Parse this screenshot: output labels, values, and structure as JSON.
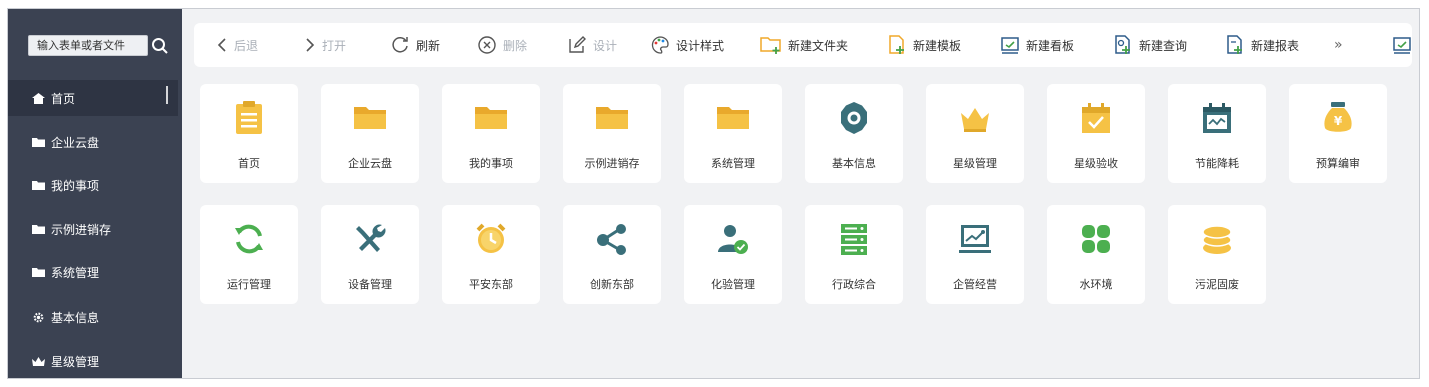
{
  "sidebar": {
    "search_placeholder": "输入表单或者文件",
    "items": [
      {
        "label": "首页",
        "icon": "home-icon"
      },
      {
        "label": "企业云盘",
        "icon": "folder-icon"
      },
      {
        "label": "我的事项",
        "icon": "folder-icon"
      },
      {
        "label": "示例进销存",
        "icon": "folder-icon"
      },
      {
        "label": "系统管理",
        "icon": "folder-icon"
      },
      {
        "label": "基本信息",
        "icon": "gear-icon"
      },
      {
        "label": "星级管理",
        "icon": "crown-icon"
      }
    ]
  },
  "toolbar": {
    "back": "后退",
    "open": "打开",
    "refresh": "刷新",
    "delete": "删除",
    "design": "设计",
    "design_style": "设计样式",
    "new_folder": "新建文件夹",
    "new_template": "新建模板",
    "new_board": "新建看板",
    "new_query": "新建查询",
    "new_report": "新建报表",
    "more": "»"
  },
  "tiles": [
    {
      "label": "首页",
      "icon": "clipboard-icon"
    },
    {
      "label": "企业云盘",
      "icon": "folder-icon"
    },
    {
      "label": "我的事项",
      "icon": "folder-icon"
    },
    {
      "label": "示例进销存",
      "icon": "folder-icon"
    },
    {
      "label": "系统管理",
      "icon": "folder-icon"
    },
    {
      "label": "基本信息",
      "icon": "gear-icon"
    },
    {
      "label": "星级管理",
      "icon": "crown-icon"
    },
    {
      "label": "星级验收",
      "icon": "calendar-check-icon"
    },
    {
      "label": "节能降耗",
      "icon": "calendar-wave-icon"
    },
    {
      "label": "预算编审",
      "icon": "money-bag-icon"
    },
    {
      "label": "运行管理",
      "icon": "refresh-icon"
    },
    {
      "label": "设备管理",
      "icon": "tools-icon"
    },
    {
      "label": "平安东部",
      "icon": "alarm-clock-icon"
    },
    {
      "label": "创新东部",
      "icon": "share-icon"
    },
    {
      "label": "化验管理",
      "icon": "user-check-icon"
    },
    {
      "label": "行政综合",
      "icon": "server-icon"
    },
    {
      "label": "企管经营",
      "icon": "monitor-chart-icon"
    },
    {
      "label": "水环境",
      "icon": "clover-icon"
    },
    {
      "label": "污泥固废",
      "icon": "coins-icon"
    }
  ],
  "colors": {
    "sidebar_bg": "#3b4252",
    "folder_yellow": "#f5c245",
    "teal_dark": "#3a6f7a",
    "green": "#4caf50"
  }
}
